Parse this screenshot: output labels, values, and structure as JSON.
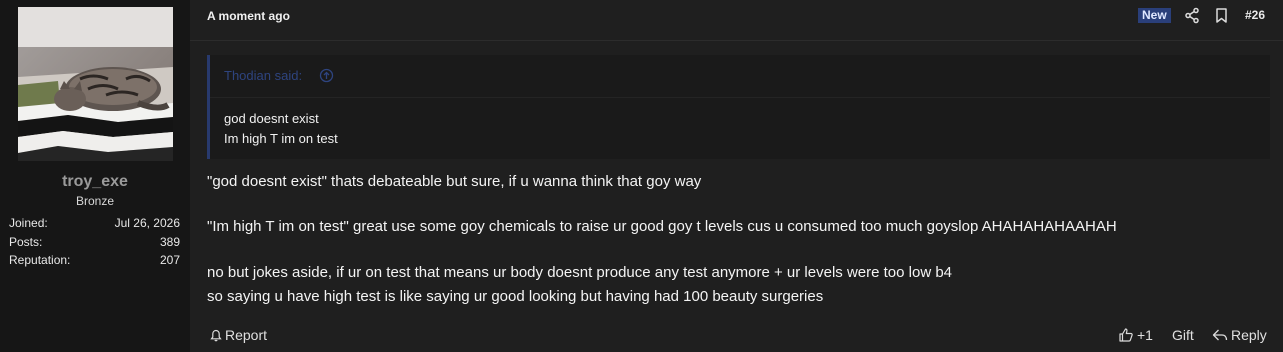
{
  "user": {
    "name": "troy_exe",
    "rank": "Bronze",
    "stats": [
      {
        "label": "Joined:",
        "value": "Jul 26, 2026"
      },
      {
        "label": "Posts:",
        "value": "389"
      },
      {
        "label": "Reputation:",
        "value": "207"
      }
    ]
  },
  "post": {
    "timestamp": "A moment ago",
    "badge": "New",
    "number": "#26",
    "quote": {
      "author": "Thodian said:",
      "lines": [
        "god doesnt exist",
        "Im high T im on test"
      ]
    },
    "body": [
      "\"god doesnt exist\" thats debateable but sure, if u wanna think that goy way",
      "\"Im high T im on test\" great use some goy chemicals to raise ur good goy t levels cus u consumed too much goyslop AHAHAHAHAAHAH",
      "no but jokes aside, if ur on test that means ur body doesnt produce any test anymore + ur levels were too low b4",
      "so saying u have high test is like saying ur good looking but having had 100 beauty surgeries"
    ]
  },
  "actions": {
    "report": "Report",
    "like_count": "+1",
    "gift": "Gift",
    "reply": "Reply"
  },
  "colors": {
    "accent": "#2a3f7a",
    "quote_link": "#2e447f",
    "background": "#1f1f1f"
  },
  "icons": [
    "share-icon",
    "bookmark-icon",
    "arrow-up-circle-icon",
    "bell-icon",
    "thumbs-up-icon",
    "reply-arrow-icon"
  ]
}
